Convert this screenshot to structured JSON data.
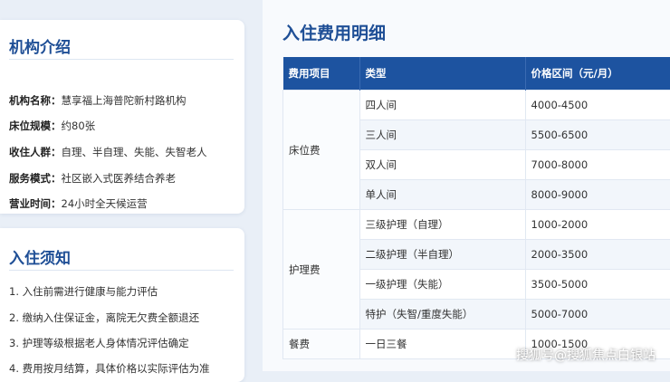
{
  "intro": {
    "title": "机构介绍",
    "rows": [
      {
        "k": "机构名称：",
        "v": "慧享福上海普陀新村路机构"
      },
      {
        "k": "床位规模：",
        "v": "约80张"
      },
      {
        "k": "收住人群：",
        "v": "自理、半自理、失能、失智老人"
      },
      {
        "k": "服务模式：",
        "v": "社区嵌入式医养结合养老"
      },
      {
        "k": "营业时间：",
        "v": "24小时全天候运营"
      }
    ]
  },
  "notes": {
    "title": "入住须知",
    "items": [
      "1. 入住前需进行健康与能力评估",
      "2. 缴纳入住保证金，离院无欠费全额退还",
      "3. 护理等级根据老人身体情况评估确定",
      "4. 费用按月结算，具体价格以实际评估为准"
    ]
  },
  "fees": {
    "title": "入住费用明细",
    "headers": [
      "费用项目",
      "类型",
      "价格区间（元/月）"
    ],
    "groups": [
      {
        "category": "床位费",
        "rows": [
          {
            "type": "四人间",
            "price": "4000-4500"
          },
          {
            "type": "三人间",
            "price": "5500-6500"
          },
          {
            "type": "双人间",
            "price": "7000-8000"
          },
          {
            "type": "单人间",
            "price": "8000-9000"
          }
        ]
      },
      {
        "category": "护理费",
        "rows": [
          {
            "type": "三级护理（自理）",
            "price": "1000-2000"
          },
          {
            "type": "二级护理（半自理）",
            "price": "2000-3500"
          },
          {
            "type": "一级护理（失能）",
            "price": "3500-5000"
          },
          {
            "type": "特护（失智/重度失能）",
            "price": "5000-7000"
          }
        ]
      },
      {
        "category": "餐费",
        "rows": [
          {
            "type": "一日三餐",
            "price": "1000-1500"
          }
        ]
      }
    ]
  },
  "watermark": "搜狐号@搜狐焦点白银站"
}
